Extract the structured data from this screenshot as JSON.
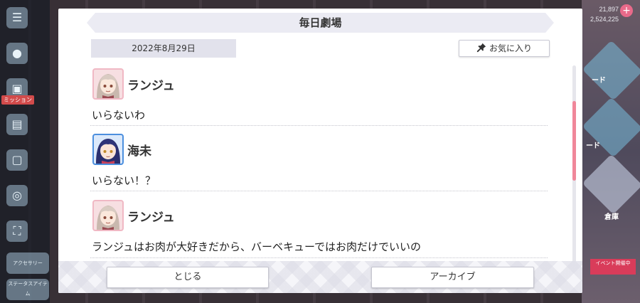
{
  "background": {
    "counter_top": "21,897",
    "counter_bottom": "2,524,225",
    "side_label": "ミッション",
    "tile_labels": [
      "ード",
      "ード",
      "倉庫"
    ],
    "bottom_badge": "イベント開催中",
    "side_buttons": [
      "アクセサリー",
      "ステータスアイテム"
    ]
  },
  "modal": {
    "title": "毎日劇場",
    "date": "2022年8月29日",
    "favorite_label": "お気に入り",
    "entries": [
      {
        "speaker": "ランジュ",
        "text": "いらないわ",
        "avatar": "ranju"
      },
      {
        "speaker": "海未",
        "text": "いらない！？",
        "avatar": "umi"
      },
      {
        "speaker": "ランジュ",
        "text": "ランジュはお肉が大好きだから、バーベキューではお肉だけでいいの",
        "avatar": "ranju"
      }
    ],
    "close_label": "とじる",
    "archive_label": "アーカイブ"
  },
  "colors": {
    "accent_pink": "#f0879a",
    "umi_frame": "#4c8fde",
    "ranju_frame": "#f0b8c4"
  },
  "icons": [
    "pin-icon",
    "avatar-ranju-icon",
    "avatar-umi-icon"
  ]
}
